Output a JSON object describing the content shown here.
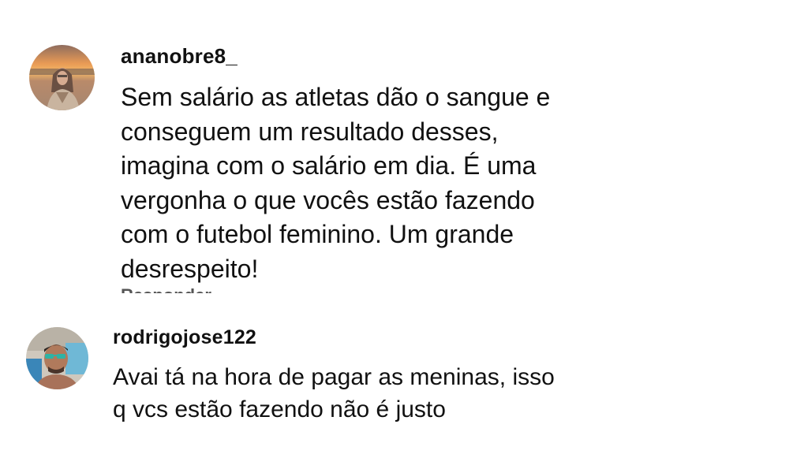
{
  "comments": [
    {
      "username": "ananobre8_",
      "avatar_icon": "profile-photo-woman-desert-sunset",
      "text": "Sem salário as atletas dão o sangue e\nconseguem um resultado desses,\nimagina com o salário em dia. É uma\nvergonha o que vocês estão fazendo\ncom o futebol feminino. Um grande\ndesrespeito!",
      "hidden_row_text": "Responder"
    },
    {
      "username": "rodrigojose122",
      "avatar_icon": "profile-photo-man-sunglasses-pool",
      "text": "Avai tá na hora de pagar as meninas, isso\nq vcs estão fazendo não é justo"
    }
  ],
  "colors": {
    "background": "#ffffff",
    "text": "#111111"
  }
}
